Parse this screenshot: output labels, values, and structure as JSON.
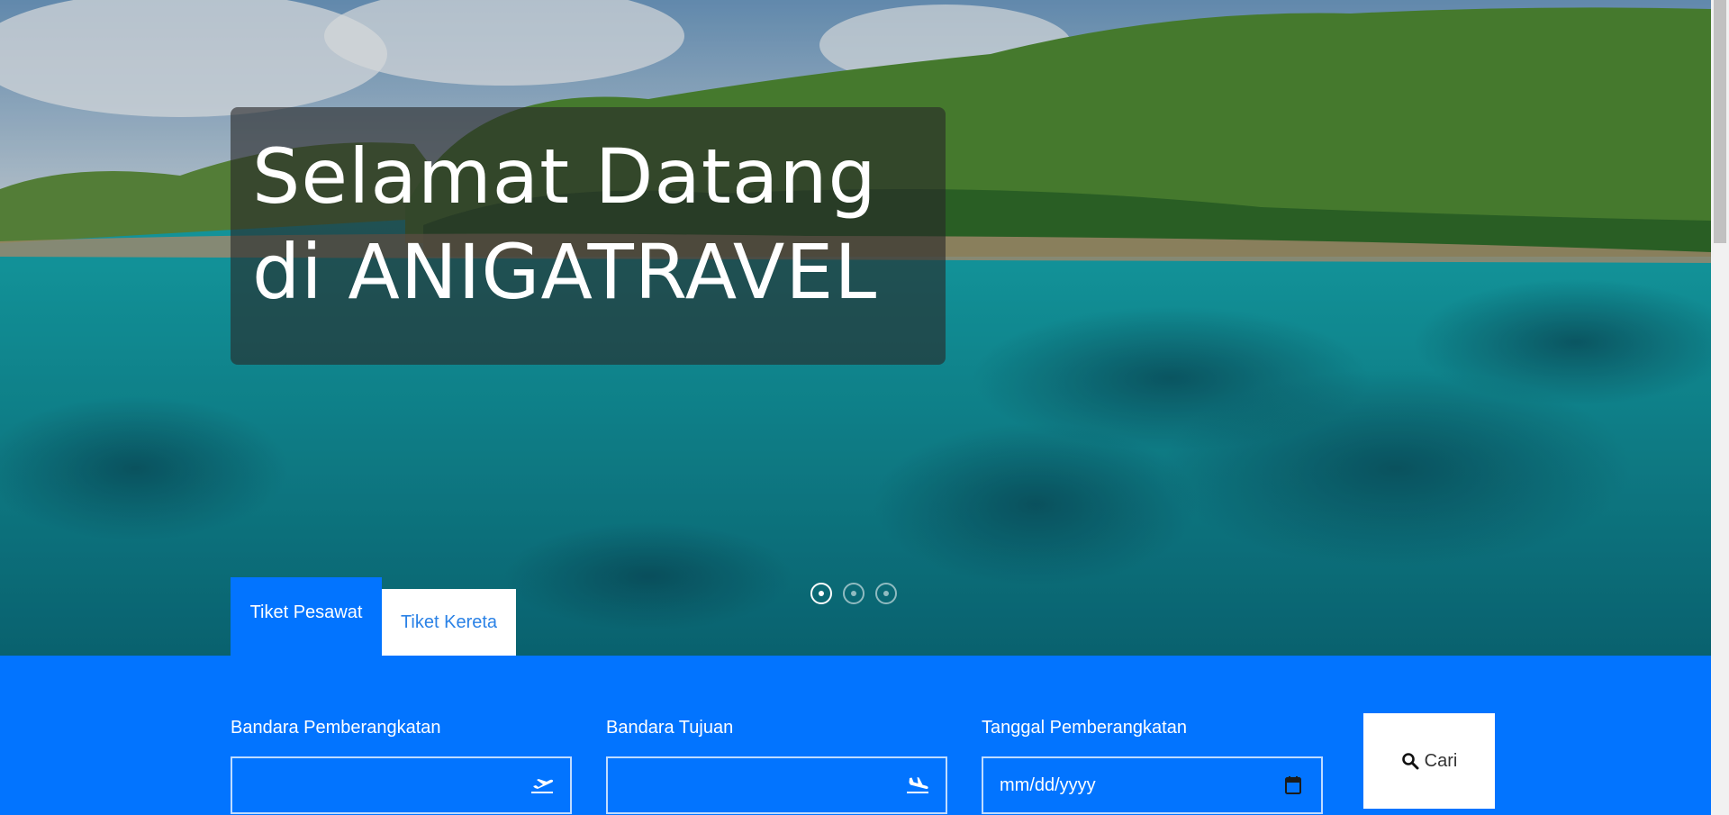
{
  "hero": {
    "title_line1": "Selamat Datang",
    "title_line2": "di ANIGATRAVEL",
    "slides_count": 3,
    "active_slide": 1
  },
  "tabs": [
    {
      "label": "Tiket Pesawat",
      "active": true
    },
    {
      "label": "Tiket Kereta",
      "active": false
    }
  ],
  "search": {
    "departure": {
      "label": "Bandara Pemberangkatan",
      "value": "",
      "icon": "plane-departure-icon"
    },
    "arrival": {
      "label": "Bandara Tujuan",
      "value": "",
      "icon": "plane-arrival-icon"
    },
    "date": {
      "label": "Tanggal Pemberangkatan",
      "placeholder": "mm/dd/yyyy",
      "icon": "calendar-icon"
    },
    "button_label": "Cari",
    "button_icon": "search-icon"
  },
  "colors": {
    "accent": "#0274ff",
    "tab_inactive_text": "#2b82e6",
    "overlay": "rgba(40,40,40,0.62)"
  }
}
